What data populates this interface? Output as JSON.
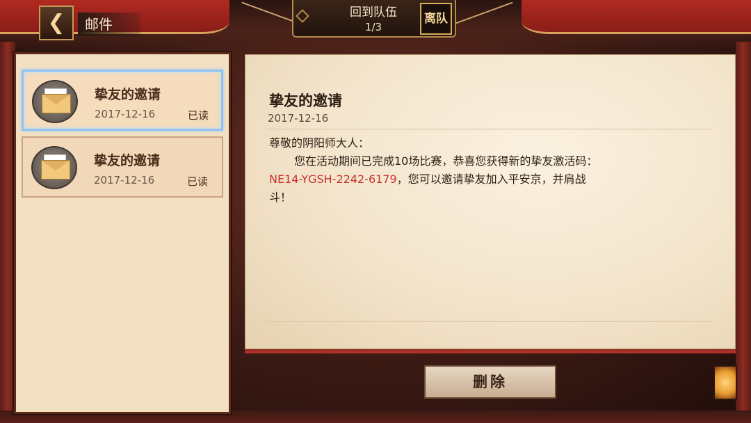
{
  "header": {
    "title": "邮件",
    "back_icon": "back-arrow-icon"
  },
  "team": {
    "label": "回到队伍",
    "count": "1/3",
    "leave_label": "离队"
  },
  "mails": [
    {
      "title": "挚友的邀请",
      "date": "2017-12-16",
      "status": "已读",
      "selected": true
    },
    {
      "title": "挚友的邀请",
      "date": "2017-12-16",
      "status": "已读",
      "selected": false
    }
  ],
  "letter": {
    "title": "挚友的邀请",
    "date": "2017-12-16",
    "greeting": "尊敬的阴阳师大人：",
    "line1": "您在活动期间已完成10场比赛，恭喜您获得新的挚友激活码：",
    "code": "NE14-YGSH-2242-6179",
    "line2": "，您可以邀请挚友加入平安京，并肩战",
    "line3": "斗！"
  },
  "actions": {
    "delete_label": "删除"
  },
  "colors": {
    "code_red": "#c8322b",
    "selected_border": "#8fc3f4"
  }
}
